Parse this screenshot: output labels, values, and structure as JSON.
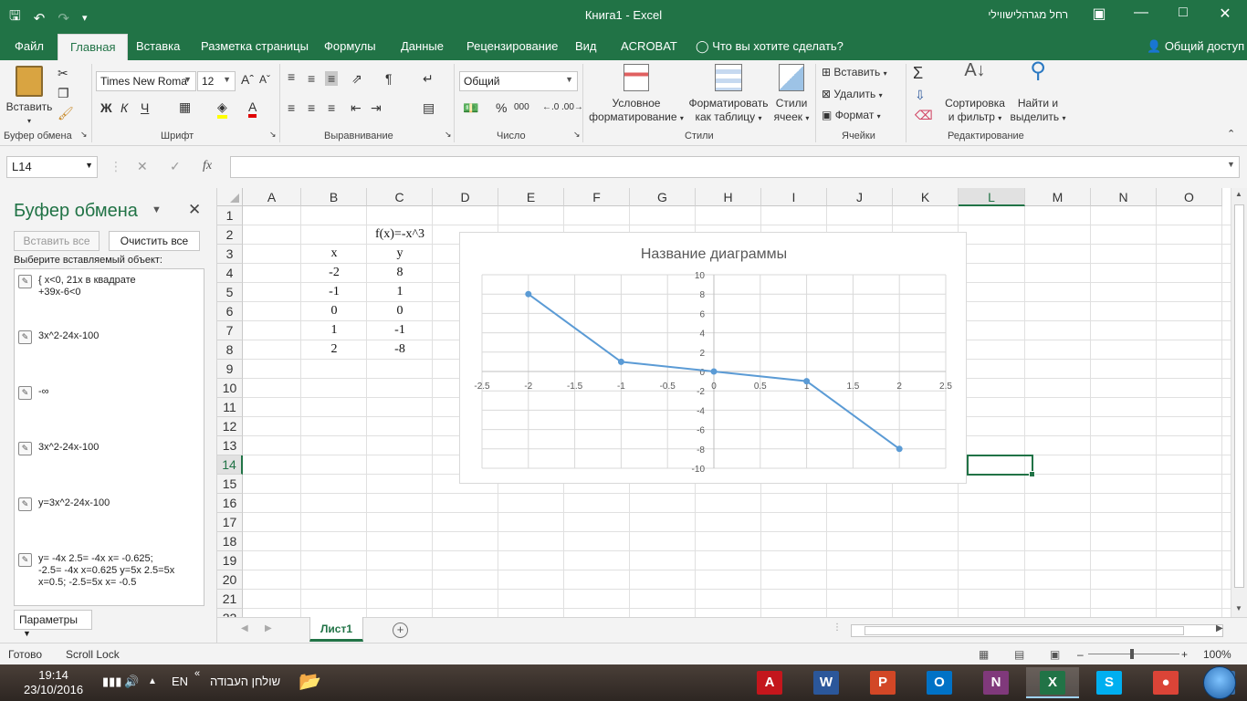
{
  "window": {
    "title": "Книга1  -  Excel",
    "user": "רחל מגרהלישווילי"
  },
  "tabs": [
    "Файл",
    "Главная",
    "Вставка",
    "Разметка страницы",
    "Формулы",
    "Данные",
    "Рецензирование",
    "Вид",
    "ACROBAT",
    "Что вы хотите сделать?"
  ],
  "share_label": "Общий доступ",
  "ribbon": {
    "paste_label": "Вставить",
    "clipboard_group": "Буфер обмена",
    "font_group": "Шрифт",
    "font_name": "Times New Roma",
    "font_size": "12",
    "bold": "Ж",
    "italic": "К",
    "underline": "Ч",
    "align_group": "Выравнивание",
    "number_group": "Число",
    "number_format": "Общий",
    "cond_format_1": "Условное",
    "cond_format_2": "форматирование",
    "format_table_1": "Форматировать",
    "format_table_2": "как таблицу",
    "cell_styles_1": "Стили",
    "cell_styles_2": "ячеек",
    "styles_group": "Стили",
    "insert_label": "Вставить",
    "delete_label": "Удалить",
    "format_label": "Формат",
    "cells_group": "Ячейки",
    "sort_1": "Сортировка",
    "sort_2": "и фильтр",
    "find_1": "Найти и",
    "find_2": "выделить",
    "editing_group": "Редактирование"
  },
  "formula_bar": {
    "name_box": "L14",
    "formula": ""
  },
  "clipboard_pane": {
    "title": "Буфер обмена",
    "paste_all": "Вставить все",
    "clear_all": "Очистить все",
    "hint": "Выберите вставляемый объект:",
    "items": [
      "{ x<0, 21x в квадрате\n+39x-6<0",
      "3x^2-24x-100",
      "-∞",
      "3x^2-24x-100",
      "y=3x^2-24x-100",
      "y= -4x 2.5= -4x x= -0.625;\n-2.5= -4x x=0.625 y=5x 2.5=5x\nx=0.5; -2.5=5x x= -0.5"
    ],
    "params": "Параметры"
  },
  "grid": {
    "columns": [
      "A",
      "B",
      "C",
      "D",
      "E",
      "F",
      "G",
      "H",
      "I",
      "J",
      "K",
      "L",
      "M",
      "N",
      "O"
    ],
    "selected_column": "L",
    "rows": [
      "1",
      "2",
      "3",
      "4",
      "5",
      "6",
      "7",
      "8",
      "9",
      "10",
      "11",
      "12",
      "13",
      "14",
      "15",
      "16",
      "17",
      "18",
      "19",
      "20",
      "21",
      "22"
    ],
    "selected_row": "14",
    "cells": {
      "C2": "f(x)=-x^3",
      "B3": "x",
      "C3": "y",
      "B4": "-2",
      "C4": "8",
      "B5": "-1",
      "C5": "1",
      "B6": "0",
      "C6": "0",
      "B7": "1",
      "C7": "-1",
      "B8": "2",
      "C8": "-8"
    }
  },
  "chart_data": {
    "type": "scatter",
    "title": "Название диаграммы",
    "x": [
      -2,
      -1,
      0,
      1,
      2
    ],
    "y": [
      8,
      1,
      0,
      -1,
      -8
    ],
    "xlim": [
      -2.5,
      2.5
    ],
    "ylim": [
      -10,
      10
    ],
    "xticks": [
      "-2.5",
      "-2",
      "-1.5",
      "-1",
      "-0.5",
      "0",
      "0.5",
      "1",
      "1.5",
      "2",
      "2.5"
    ],
    "yticks": [
      "10",
      "8",
      "6",
      "4",
      "2",
      "0",
      "-2",
      "-4",
      "-6",
      "-8",
      "-10"
    ],
    "grid": true,
    "line_color": "#5b9bd5"
  },
  "sheet_tab": "Лист1",
  "status": {
    "ready": "Готово",
    "scroll_lock": "Scroll Lock",
    "zoom": "100%"
  },
  "taskbar": {
    "time": "19:14",
    "date": "23/10/2016",
    "lang": "EN",
    "desktop": "שולחן העבודה",
    "apps": [
      {
        "name": "acrobat",
        "label": "A",
        "color": "#c4161c"
      },
      {
        "name": "word",
        "label": "W",
        "color": "#2b579a"
      },
      {
        "name": "powerpoint",
        "label": "P",
        "color": "#d24726"
      },
      {
        "name": "outlook",
        "label": "O",
        "color": "#0072c6"
      },
      {
        "name": "onenote",
        "label": "N",
        "color": "#80397b"
      },
      {
        "name": "excel",
        "label": "X",
        "color": "#217346"
      },
      {
        "name": "skype",
        "label": "S",
        "color": "#00aff0"
      },
      {
        "name": "chrome",
        "label": "●",
        "color": "#db4437"
      },
      {
        "name": "media",
        "label": "▶",
        "color": "#3a6ea5"
      }
    ]
  },
  "colors": {
    "accent": "#217346"
  }
}
